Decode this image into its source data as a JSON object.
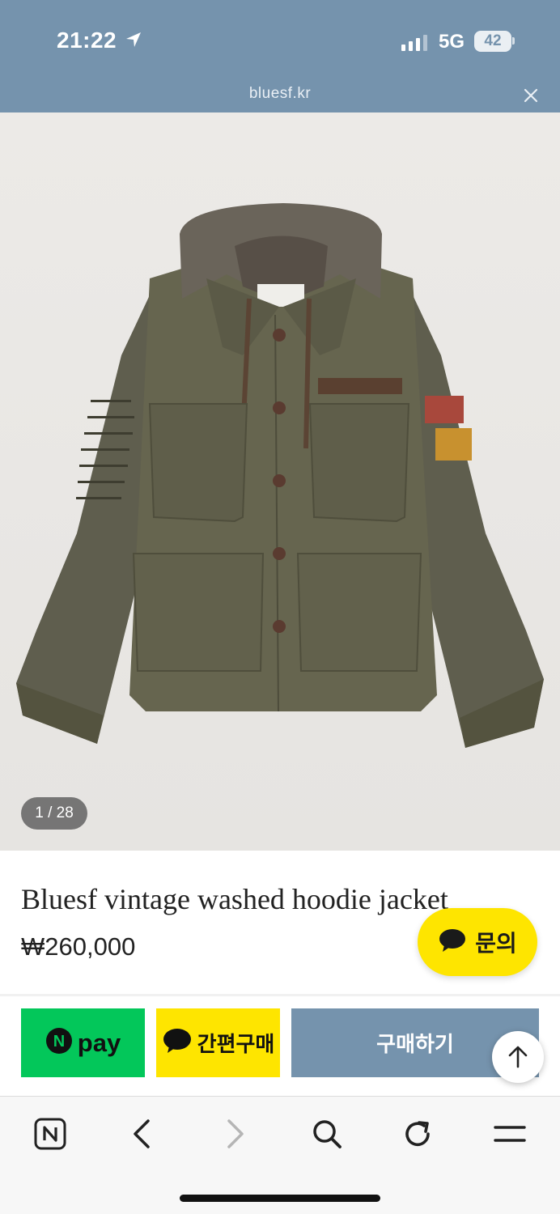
{
  "status_bar": {
    "time": "21:22",
    "network": "5G",
    "battery": "42"
  },
  "browser": {
    "url": "bluesf.kr"
  },
  "gallery": {
    "counter": "1 / 28"
  },
  "product": {
    "title": "Bluesf vintage washed hoodie jacket",
    "price": "₩260,000"
  },
  "inquiry_button": {
    "label": "문의",
    "color": "#fee500"
  },
  "actions": {
    "npay_label": "pay",
    "npay_badge": "N",
    "kakao_label": "간편구매",
    "buy_label": "구매하기"
  },
  "colors": {
    "brand": "#7593ad",
    "npay_green": "#03c75a",
    "kakao_yellow": "#fee500"
  },
  "toolbar": {
    "icons": [
      "naver-icon",
      "back-icon",
      "forward-icon",
      "search-icon",
      "reload-icon",
      "menu-icon"
    ]
  }
}
